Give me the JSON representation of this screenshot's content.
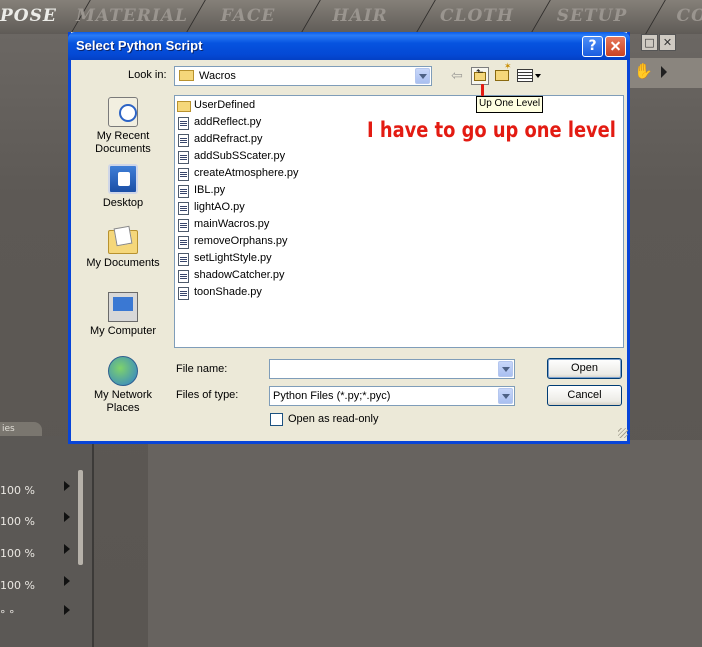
{
  "app_tabs": [
    "POSE",
    "MATERIAL",
    "FACE",
    "HAIR",
    "CLOTH",
    "SETUP",
    "CON"
  ],
  "background": {
    "left_tab_label": "ies",
    "percent_rows": [
      "100 %",
      "100 %",
      "100 %",
      "100 %",
      "° °"
    ]
  },
  "dialog": {
    "title": "Select Python Script",
    "help_label": "?",
    "look_in_label": "Look in:",
    "look_in_value": "Wacros",
    "tooltip": "Up One Level",
    "places": [
      {
        "label": "My Recent Documents",
        "icon": "recent-documents-icon"
      },
      {
        "label": "Desktop",
        "icon": "desktop-icon"
      },
      {
        "label": "My Documents",
        "icon": "my-documents-icon"
      },
      {
        "label": "My Computer",
        "icon": "my-computer-icon"
      },
      {
        "label": "My Network Places",
        "icon": "network-places-icon"
      }
    ],
    "files": [
      {
        "name": "UserDefined",
        "type": "folder"
      },
      {
        "name": "addReflect.py",
        "type": "file"
      },
      {
        "name": "addRefract.py",
        "type": "file"
      },
      {
        "name": "addSubSScater.py",
        "type": "file"
      },
      {
        "name": "createAtmosphere.py",
        "type": "file"
      },
      {
        "name": "IBL.py",
        "type": "file"
      },
      {
        "name": "lightAO.py",
        "type": "file"
      },
      {
        "name": "mainWacros.py",
        "type": "file"
      },
      {
        "name": "removeOrphans.py",
        "type": "file"
      },
      {
        "name": "setLightStyle.py",
        "type": "file"
      },
      {
        "name": "shadowCatcher.py",
        "type": "file"
      },
      {
        "name": "toonShade.py",
        "type": "file"
      }
    ],
    "file_name_label": "File name:",
    "file_name_value": "",
    "file_type_label": "Files of type:",
    "file_type_value": "Python Files (*.py;*.pyc)",
    "open_label": "Open",
    "cancel_label": "Cancel",
    "readonly_label": "Open as read-only"
  },
  "annotation": "I have to go up one level",
  "colors": {
    "title_bar": "#0653df",
    "annotation": "#e31b12",
    "dialog_face": "#ece9d8"
  }
}
